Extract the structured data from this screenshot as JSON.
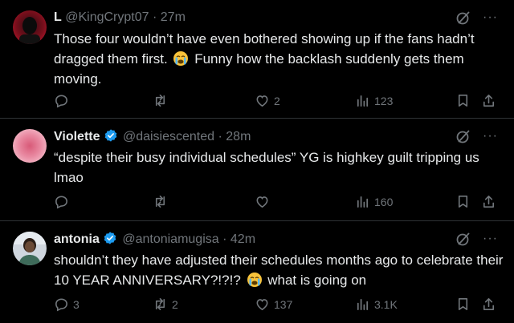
{
  "tweets": [
    {
      "name": "L",
      "handle": "@KingCrypt07",
      "dot": "·",
      "time": "27m",
      "verified": false,
      "text_lines": [
        "Those four wouldn’t have even bothered showing up if the fans hadn’t",
        "dragged them first.",
        "Funny how the backlash suddenly gets them",
        "moving."
      ],
      "emoji": "crying-face",
      "replies": "",
      "retweets": "",
      "likes": "2",
      "views": "123"
    },
    {
      "name": "Violette",
      "handle": "@daisiescented",
      "dot": "·",
      "time": "28m",
      "verified": true,
      "text_lines": [
        "“despite their busy individual schedules” YG is highkey guilt tripping us",
        "lmao"
      ],
      "replies": "",
      "retweets": "",
      "likes": "",
      "views": "160"
    },
    {
      "name": "antonia",
      "handle": "@antoniamugisa",
      "dot": "·",
      "time": "42m",
      "verified": true,
      "text_lines": [
        "shouldn’t they have adjusted their schedules months ago to celebrate their",
        "10 YEAR ANNIVERSARY?!?!?",
        "what is going on"
      ],
      "emoji": "crying-face",
      "replies": "3",
      "retweets": "2",
      "likes": "137",
      "views": "3.1K"
    }
  ],
  "header_more": "···",
  "colors": {
    "background": "#000000",
    "text": "#e7e9ea",
    "muted": "#71767b",
    "divider": "#2f3336",
    "verified": "#1d9bf0"
  }
}
